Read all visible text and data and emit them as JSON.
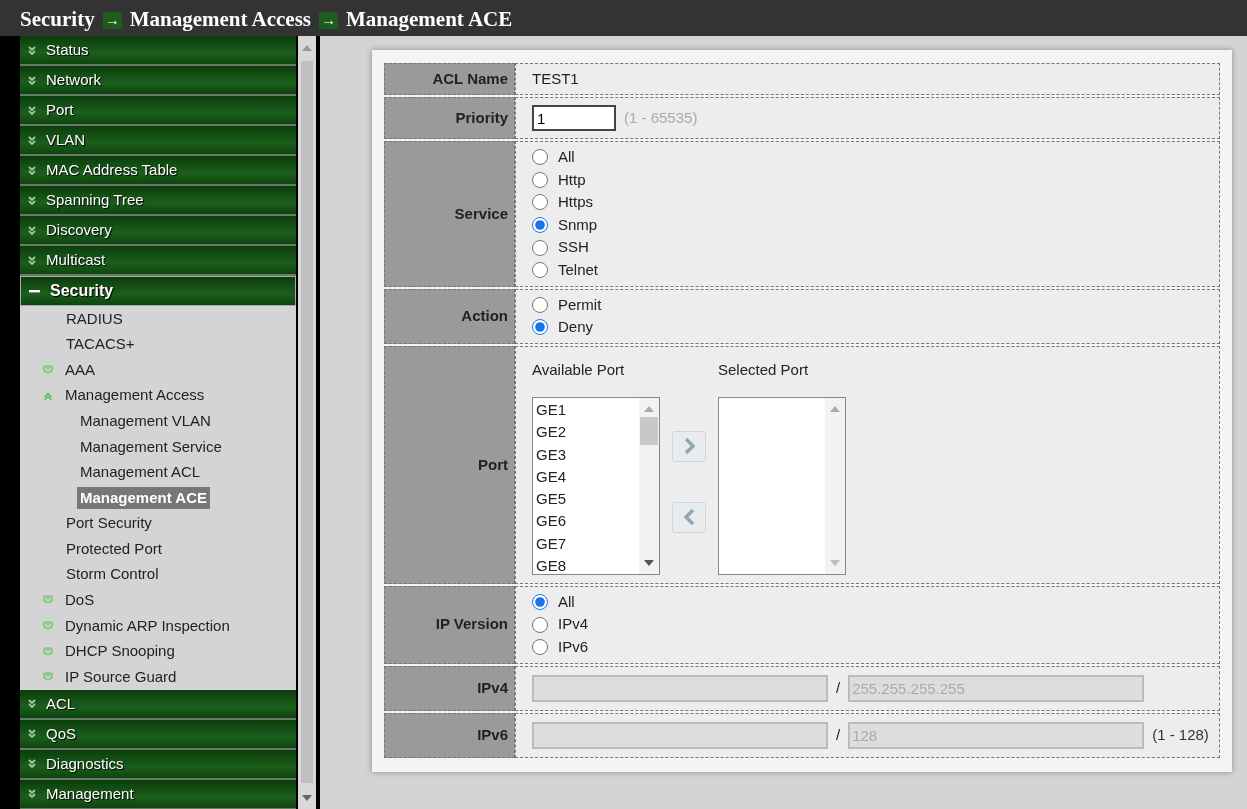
{
  "breadcrumb": [
    {
      "kind": "crumb",
      "text": "Security"
    },
    {
      "kind": "arrow",
      "text": "→"
    },
    {
      "kind": "crumb",
      "text": "Management Access"
    },
    {
      "kind": "arrow",
      "text": "→"
    },
    {
      "kind": "crumb",
      "text": "Management ACE"
    }
  ],
  "sidebar": {
    "items": [
      {
        "label": "Status",
        "expanded": false,
        "selected": false
      },
      {
        "label": "Network",
        "expanded": false,
        "selected": false
      },
      {
        "label": "Port",
        "expanded": false,
        "selected": false
      },
      {
        "label": "VLAN",
        "expanded": false,
        "selected": false
      },
      {
        "label": "MAC Address Table",
        "expanded": false,
        "selected": false
      },
      {
        "label": "Spanning Tree",
        "expanded": false,
        "selected": false
      },
      {
        "label": "Discovery",
        "expanded": false,
        "selected": false
      },
      {
        "label": "Multicast",
        "expanded": false,
        "selected": false
      },
      {
        "label": "Security",
        "expanded": true,
        "selected": false,
        "children": [
          {
            "label": "RADIUS",
            "selected": false
          },
          {
            "label": "TACACS+",
            "selected": false
          },
          {
            "label": "AAA",
            "expanded": false,
            "selected": false
          },
          {
            "label": "Management Access",
            "expanded": true,
            "selected": false,
            "children": [
              {
                "label": "Management VLAN",
                "selected": false
              },
              {
                "label": "Management Service",
                "selected": false
              },
              {
                "label": "Management ACL",
                "selected": false
              },
              {
                "label": "Management ACE",
                "selected": true
              }
            ]
          },
          {
            "label": "Port Security",
            "selected": false
          },
          {
            "label": "Protected Port",
            "selected": false
          },
          {
            "label": "Storm Control",
            "selected": false
          },
          {
            "label": "DoS",
            "expanded": false,
            "selected": false
          },
          {
            "label": "Dynamic ARP Inspection",
            "expanded": false,
            "selected": false
          },
          {
            "label": "DHCP Snooping",
            "expanded": false,
            "selected": false
          },
          {
            "label": "IP Source Guard",
            "expanded": false,
            "selected": false
          }
        ]
      },
      {
        "label": "ACL",
        "expanded": false,
        "selected": false
      },
      {
        "label": "QoS",
        "expanded": false,
        "selected": false
      },
      {
        "label": "Diagnostics",
        "expanded": false,
        "selected": false
      },
      {
        "label": "Management",
        "expanded": false,
        "selected": false
      }
    ]
  },
  "form": {
    "rows": [
      {
        "kind": "text",
        "label": "ACL Name",
        "value": "TEST1"
      },
      {
        "kind": "input",
        "label": "Priority",
        "value": "1",
        "hint": "(1 - 65535)"
      },
      {
        "kind": "radio",
        "label": "Service",
        "options": [
          {
            "label": "All",
            "selected": false
          },
          {
            "label": "Http",
            "selected": false
          },
          {
            "label": "Https",
            "selected": false
          },
          {
            "label": "Snmp",
            "selected": true
          },
          {
            "label": "SSH",
            "selected": false
          },
          {
            "label": "Telnet",
            "selected": false
          }
        ]
      },
      {
        "kind": "radio",
        "label": "Action",
        "options": [
          {
            "label": "Permit",
            "selected": false
          },
          {
            "label": "Deny",
            "selected": true
          }
        ]
      },
      {
        "kind": "ports",
        "label": "Port",
        "available": {
          "title": "Available Port",
          "items": [
            "GE1",
            "GE2",
            "GE3",
            "GE4",
            "GE5",
            "GE6",
            "GE7",
            "GE8"
          ]
        },
        "chosen": {
          "title": "Selected Port"
        }
      },
      {
        "kind": "radio",
        "label": "IP Version",
        "options": [
          {
            "label": "All",
            "selected": true
          },
          {
            "label": "IPv4",
            "selected": false
          },
          {
            "label": "IPv6",
            "selected": false
          }
        ]
      },
      {
        "kind": "address",
        "label": "IPv4",
        "address": {
          "disabled": true
        },
        "separator": "/",
        "mask": {
          "placeholder": "255.255.255.255",
          "disabled": true
        }
      },
      {
        "kind": "address",
        "label": "IPv6",
        "address": {
          "disabled": true
        },
        "separator": "/",
        "mask": {
          "placeholder": "128",
          "disabled": true
        },
        "hint": "(1 - 128)"
      }
    ]
  }
}
